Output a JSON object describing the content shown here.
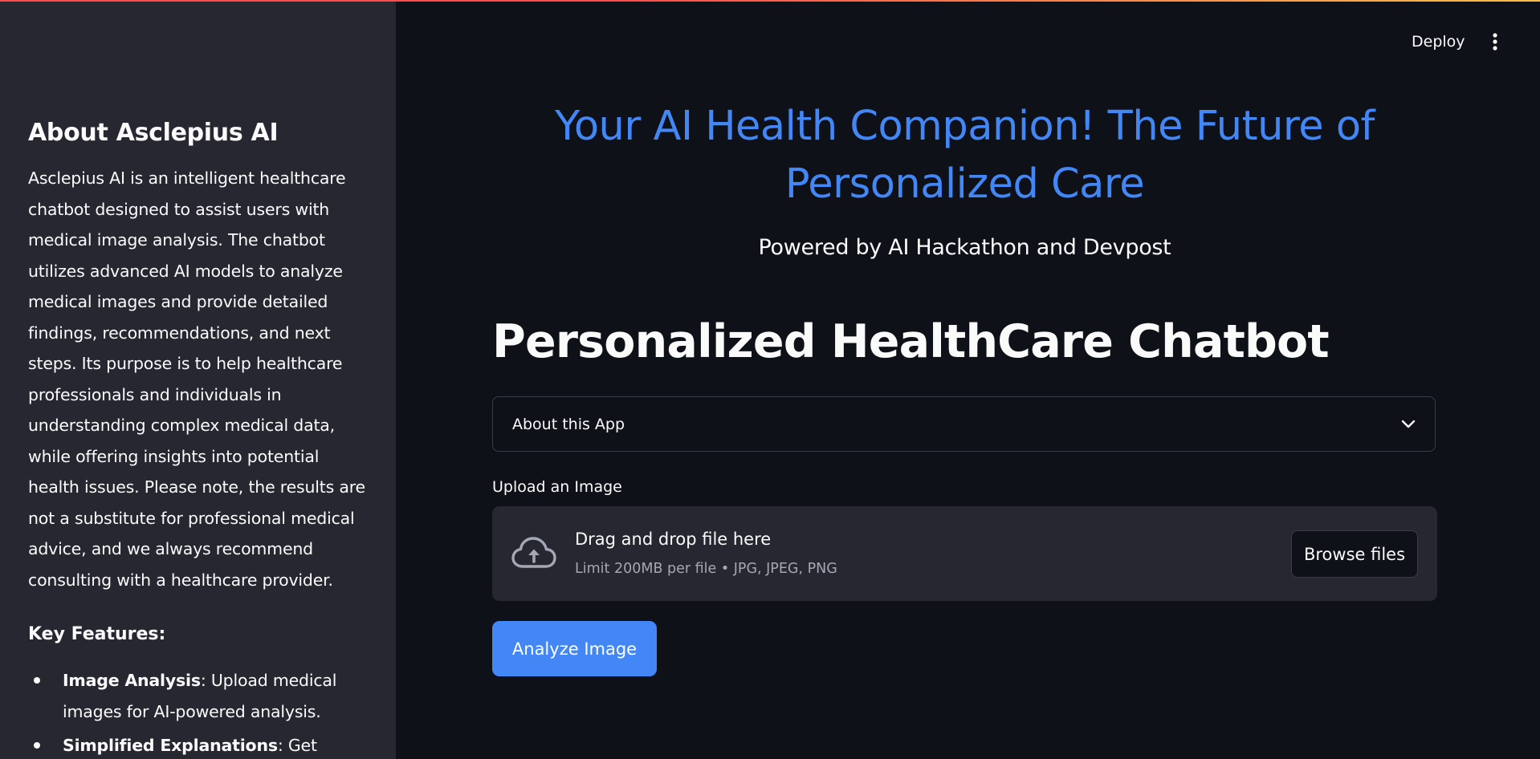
{
  "header": {
    "deploy_label": "Deploy",
    "menu_icon": "vertical-dots-icon"
  },
  "sidebar": {
    "title": "About Asclepius AI",
    "description": "Asclepius AI is an intelligent healthcare chatbot designed to assist users with medical image analysis. The chatbot utilizes advanced AI models to analyze medical images and provide detailed findings, recommendations, and next steps. Its purpose is to help healthcare professionals and individuals in understanding complex medical data, while offering insights into potential health issues. Please note, the results are not a substitute for professional medical advice, and we always recommend consulting with a healthcare provider.",
    "features_title": "Key Features:",
    "features": [
      {
        "name": "Image Analysis",
        "text": ": Upload medical images for AI-powered analysis."
      },
      {
        "name": "Simplified Explanations",
        "text": ": Get easy-to-understand explanations."
      }
    ]
  },
  "main": {
    "hero_title": "Your AI Health Companion! The Future of Personalized Care",
    "hero_subtitle": "Powered by AI Hackathon and Devpost",
    "app_title": "Personalized HealthCare Chatbot",
    "expander_label": "About this App",
    "upload_label": "Upload an Image",
    "dropzone_title": "Drag and drop file here",
    "dropzone_limit": "Limit 200MB per file • JPG, JPEG, PNG",
    "browse_label": "Browse files",
    "analyze_label": "Analyze Image"
  },
  "colors": {
    "accent": "#4287f5",
    "background": "#0e1117",
    "sidebar_bg": "#262730",
    "text": "#fafafa"
  }
}
